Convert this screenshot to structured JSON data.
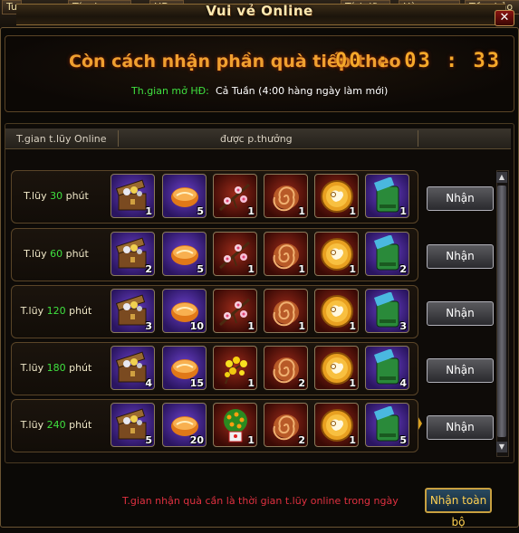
{
  "window": {
    "title": "Vui vẻ Online",
    "top_tabs": [
      "Tu",
      "Tín dụng",
      "HD",
      "Tích lũy",
      "Hàng ngày",
      "Tầm bảo"
    ]
  },
  "countdown": {
    "label": "Còn cách nhận phần quà tiếp theo",
    "timer": "00 : 03 : 33",
    "event_time_label": "Th.gian mở HĐ:",
    "event_time_value": "Cả Tuần (4:00 hàng ngày làm mới)"
  },
  "table": {
    "col_time": "T.gian t.lũy Online",
    "col_reward": "được p.thưởng"
  },
  "tiers": [
    {
      "prefix": "T.lũy",
      "minutes": "30",
      "unit": "phút",
      "button": "Nhận",
      "items": [
        {
          "icon": "treasure-chest-icon",
          "bg": "purple",
          "qty": "1"
        },
        {
          "icon": "bread-icon",
          "bg": "purple",
          "qty": "5"
        },
        {
          "icon": "cherry-blossom-icon",
          "bg": "red",
          "qty": "1"
        },
        {
          "icon": "swirl-scroll-icon",
          "bg": "red",
          "qty": "1"
        },
        {
          "icon": "gold-ram-coin-icon",
          "bg": "red",
          "qty": "1"
        },
        {
          "icon": "green-pouch-icon",
          "bg": "purple",
          "qty": "1"
        }
      ]
    },
    {
      "prefix": "T.lũy",
      "minutes": "60",
      "unit": "phút",
      "button": "Nhận",
      "items": [
        {
          "icon": "treasure-chest-icon",
          "bg": "purple",
          "qty": "2"
        },
        {
          "icon": "bread-icon",
          "bg": "purple",
          "qty": "5"
        },
        {
          "icon": "cherry-blossom-icon",
          "bg": "red",
          "qty": "1"
        },
        {
          "icon": "swirl-scroll-icon",
          "bg": "red",
          "qty": "1"
        },
        {
          "icon": "gold-ram-coin-icon",
          "bg": "red",
          "qty": "1"
        },
        {
          "icon": "green-pouch-icon",
          "bg": "purple",
          "qty": "2"
        }
      ]
    },
    {
      "prefix": "T.lũy",
      "minutes": "120",
      "unit": "phút",
      "button": "Nhận",
      "items": [
        {
          "icon": "treasure-chest-icon",
          "bg": "purple",
          "qty": "3"
        },
        {
          "icon": "bread-icon",
          "bg": "purple",
          "qty": "10"
        },
        {
          "icon": "cherry-blossom-icon",
          "bg": "red",
          "qty": "1"
        },
        {
          "icon": "swirl-scroll-icon",
          "bg": "red",
          "qty": "1"
        },
        {
          "icon": "gold-ram-coin-icon",
          "bg": "red",
          "qty": "1"
        },
        {
          "icon": "green-pouch-icon",
          "bg": "purple",
          "qty": "3"
        }
      ]
    },
    {
      "prefix": "T.lũy",
      "minutes": "180",
      "unit": "phút",
      "button": "Nhận",
      "items": [
        {
          "icon": "treasure-chest-icon",
          "bg": "purple",
          "qty": "4"
        },
        {
          "icon": "bread-icon",
          "bg": "purple",
          "qty": "15"
        },
        {
          "icon": "yellow-apricot-blossom-icon",
          "bg": "red",
          "qty": "1"
        },
        {
          "icon": "swirl-scroll-icon",
          "bg": "red",
          "qty": "2"
        },
        {
          "icon": "gold-ram-coin-icon",
          "bg": "red",
          "qty": "1"
        },
        {
          "icon": "green-pouch-icon",
          "bg": "purple",
          "qty": "4"
        }
      ]
    },
    {
      "prefix": "T.lũy",
      "minutes": "240",
      "unit": "phút",
      "button": "Nhận",
      "items": [
        {
          "icon": "treasure-chest-icon",
          "bg": "purple",
          "qty": "5"
        },
        {
          "icon": "bread-icon",
          "bg": "purple",
          "qty": "20"
        },
        {
          "icon": "kumquat-tree-icon",
          "bg": "red",
          "qty": "1"
        },
        {
          "icon": "swirl-scroll-icon",
          "bg": "red",
          "qty": "2"
        },
        {
          "icon": "gold-ram-coin-icon",
          "bg": "red",
          "qty": "1"
        },
        {
          "icon": "green-pouch-icon",
          "bg": "purple",
          "qty": "5"
        }
      ]
    }
  ],
  "footer": {
    "note": "T.gian nhận quà cần là thời gian t.lũy online trong ngày",
    "claim_all": "Nhận toàn bộ"
  },
  "colors": {
    "accent_orange": "#f0a030",
    "minutes_green": "#3fe03f",
    "note_red": "#e03040",
    "claim_all_text": "#ffd050"
  }
}
